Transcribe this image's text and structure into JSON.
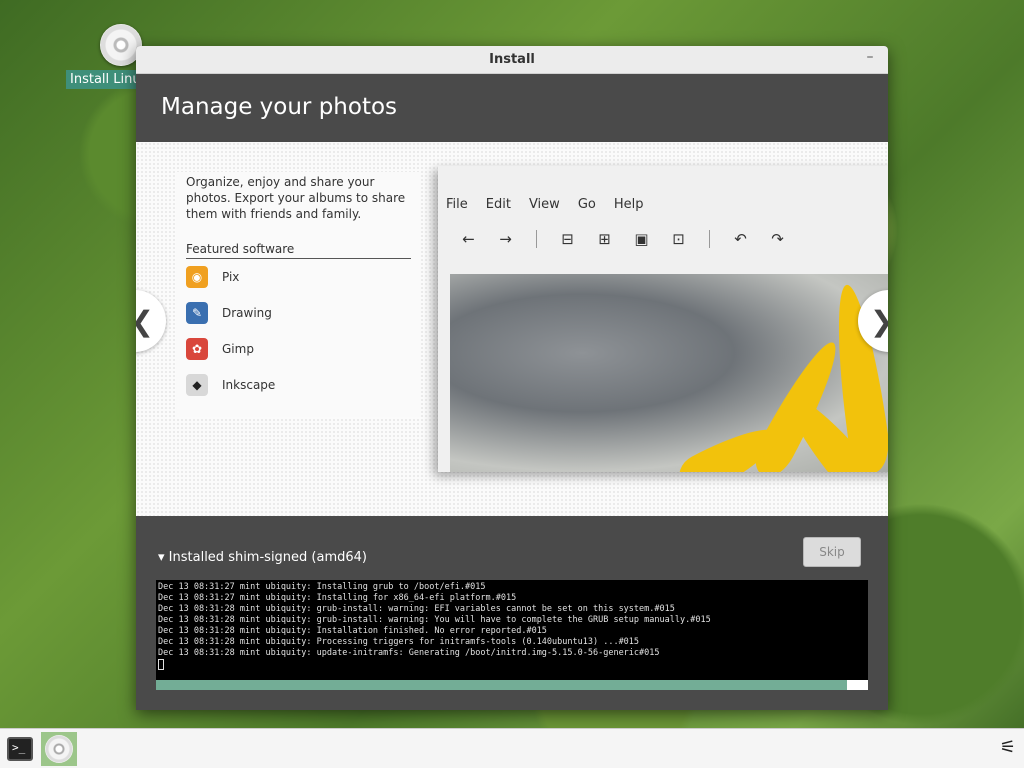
{
  "desktop": {
    "icon_label": "Install Linu"
  },
  "window": {
    "title": "Install",
    "minimize_symbol": "–"
  },
  "slide": {
    "heading": "Manage your photos",
    "description": "Organize, enjoy and share your photos. Export your albums to share them with friends and family.",
    "featured_title": "Featured software",
    "apps": [
      {
        "name": "Pix",
        "icon": "pix-icon",
        "color": "#f0a020"
      },
      {
        "name": "Drawing",
        "icon": "drawing-icon",
        "color": "#3a6fb0"
      },
      {
        "name": "Gimp",
        "icon": "gimp-icon",
        "color": "#d9473c"
      },
      {
        "name": "Inkscape",
        "icon": "inkscape-icon",
        "color": "#d8d8d8"
      }
    ],
    "screenshot_menu": [
      "File",
      "Edit",
      "View",
      "Go",
      "Help"
    ],
    "prev_symbol": "❮",
    "next_symbol": "❯"
  },
  "progress": {
    "status": "Installed shim-signed (amd64)",
    "skip_label": "Skip",
    "fraction": 0.97
  },
  "terminal": {
    "lines": [
      "Dec 13 08:31:27 mint ubiquity: Installing grub to /boot/efi.#015",
      "Dec 13 08:31:27 mint ubiquity: Installing for x86_64-efi platform.#015",
      "Dec 13 08:31:28 mint ubiquity: grub-install: warning: EFI variables cannot be set on this system.#015",
      "Dec 13 08:31:28 mint ubiquity: grub-install: warning: You will have to complete the GRUB setup manually.#015",
      "Dec 13 08:31:28 mint ubiquity: Installation finished. No error reported.#015",
      "Dec 13 08:31:28 mint ubiquity: Processing triggers for initramfs-tools (0.140ubuntu13) ...#015",
      "Dec 13 08:31:28 mint ubiquity: update-initramfs: Generating /boot/initrd.img-5.15.0-56-generic#015"
    ]
  },
  "taskbar": {
    "terminal_glyph": ">_"
  },
  "colors": {
    "accent": "#73ad96",
    "header_bg": "#4a4a4a",
    "desktop_label_bg": "#3f8f7a"
  }
}
